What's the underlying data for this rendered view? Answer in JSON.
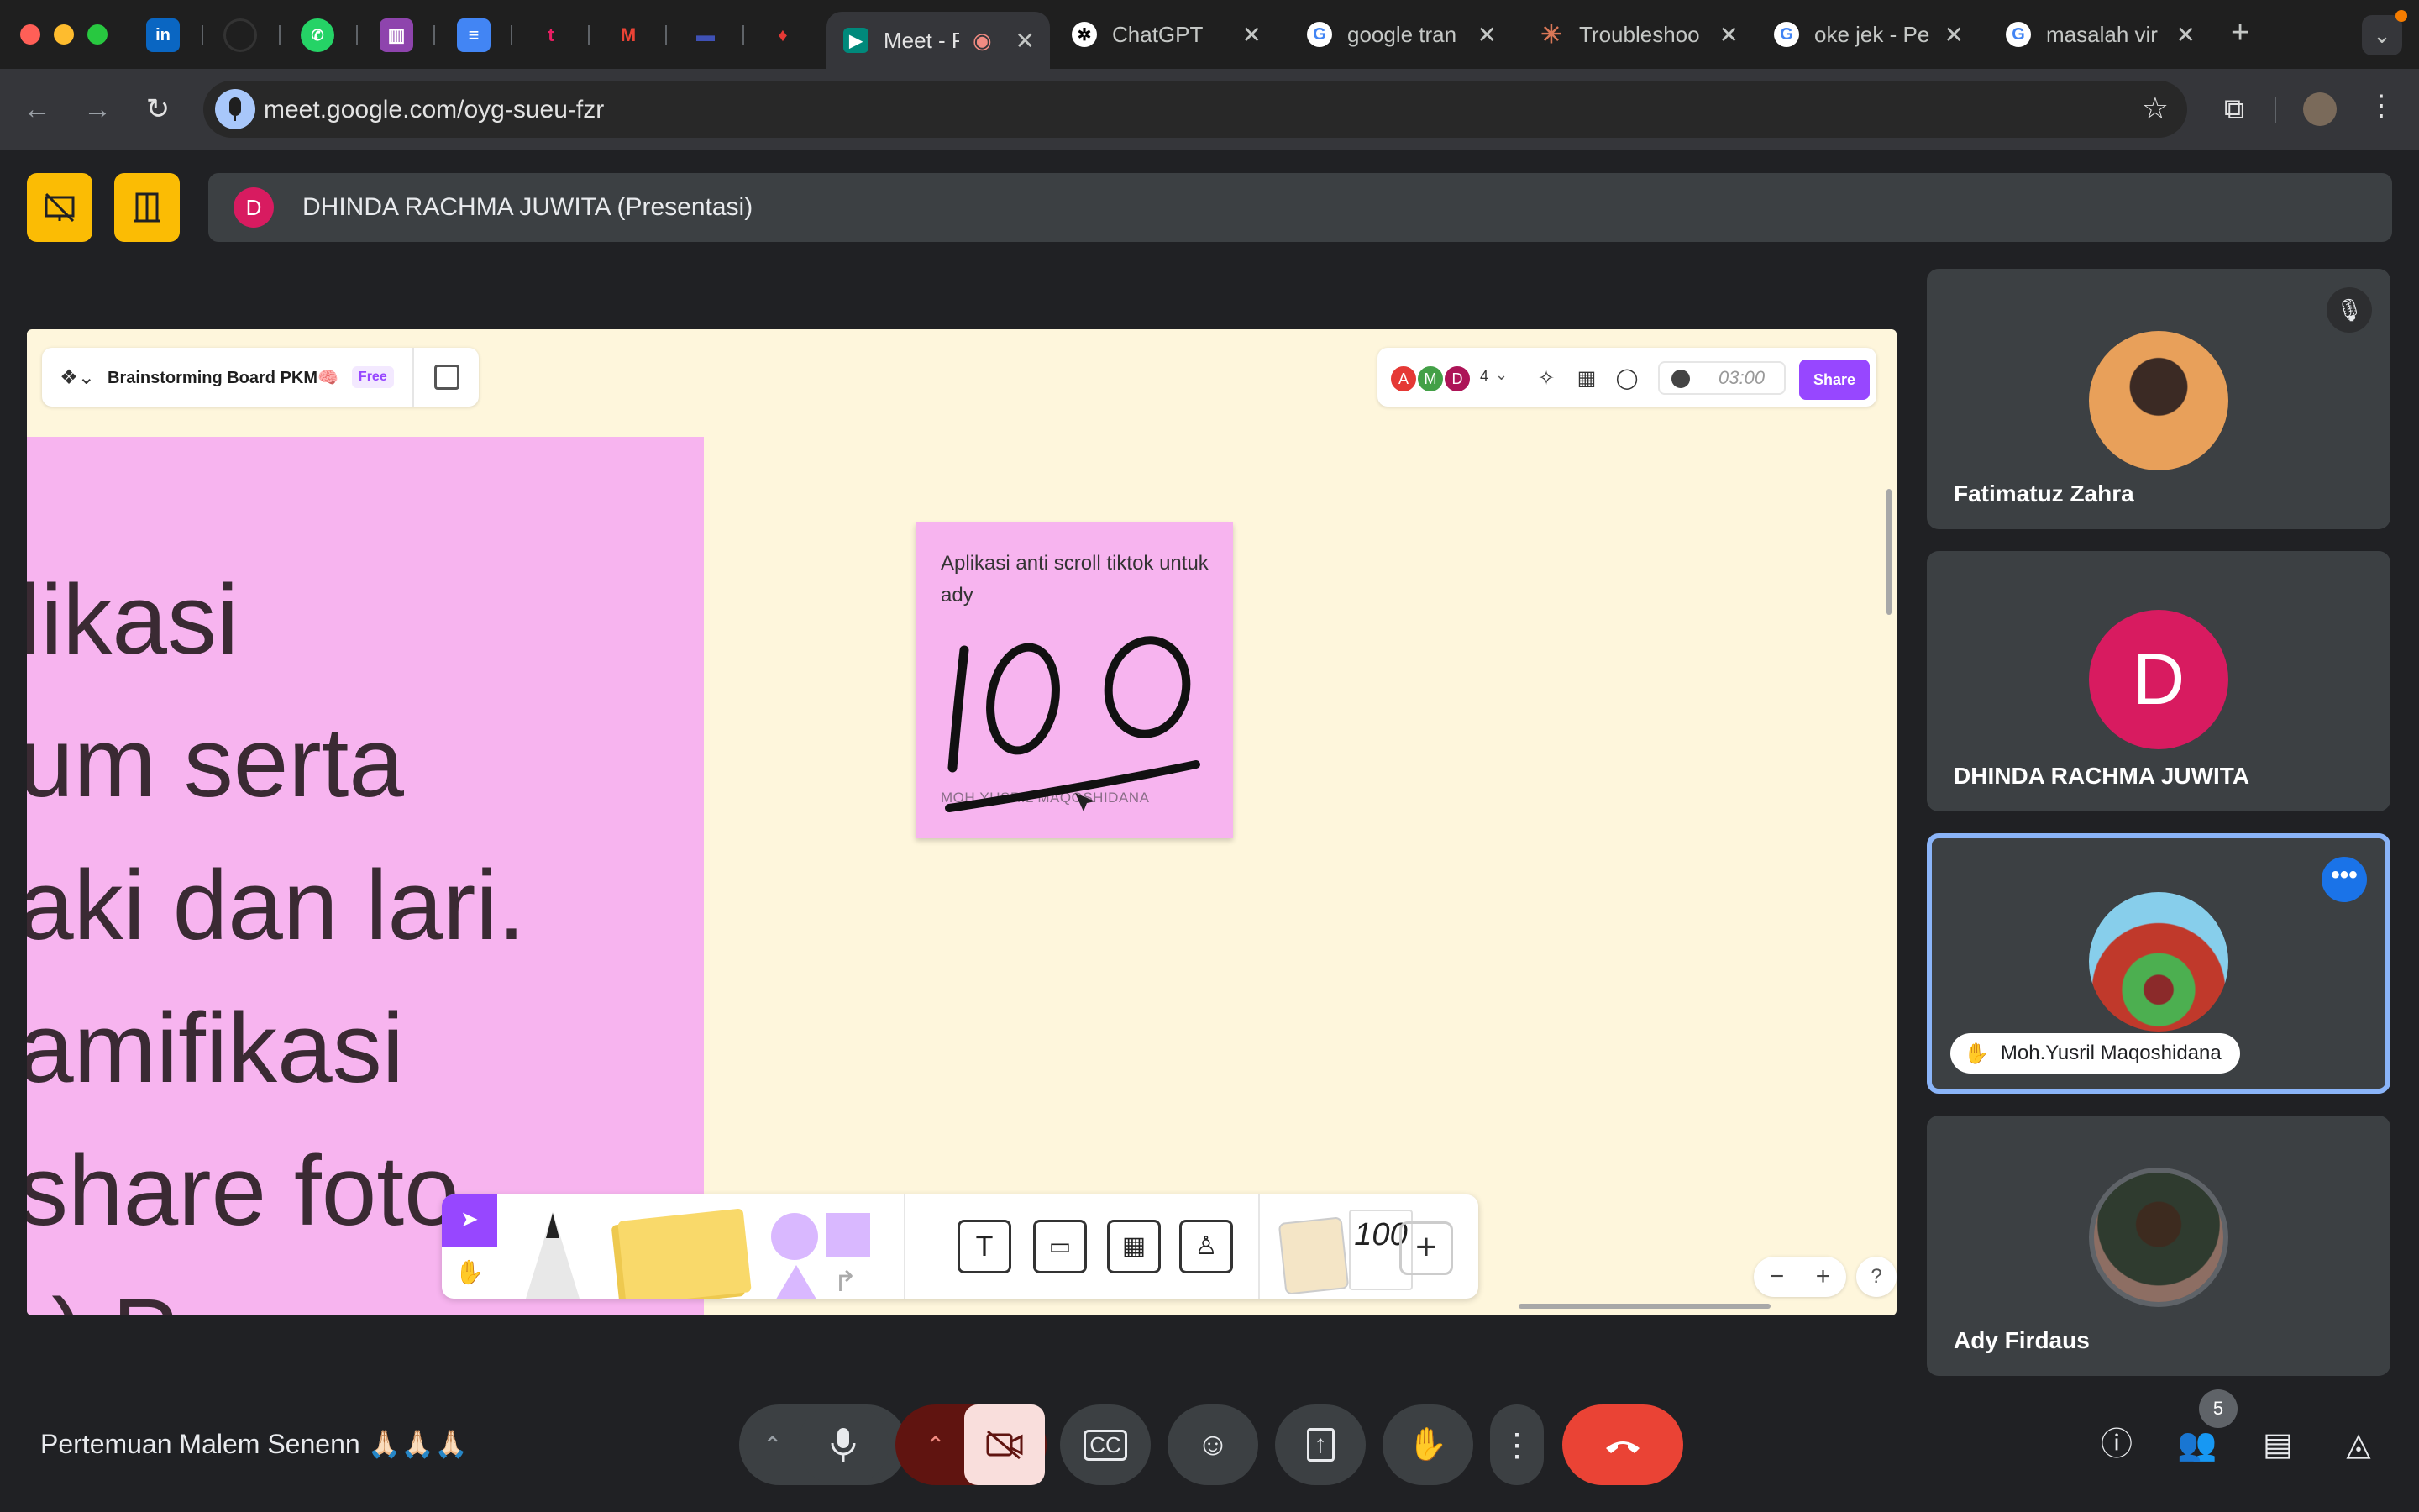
{
  "browser": {
    "tabs": [
      {
        "title": "Meet - P",
        "favicon": "google-meet-icon"
      },
      {
        "title": "ChatGPT",
        "favicon": "chatgpt-icon"
      },
      {
        "title": "google tran",
        "favicon": "google-icon"
      },
      {
        "title": "Troubleshoo",
        "favicon": "claude-icon"
      },
      {
        "title": "oke jek - Pe",
        "favicon": "google-icon"
      },
      {
        "title": "masalah vir",
        "favicon": "google-icon"
      }
    ],
    "pinned_icons": [
      "linkedin-icon",
      "github-icon",
      "whatsapp-icon",
      "trello-icon",
      "docs-icon",
      "tiktok-icon",
      "gmail-icon",
      "bank-icon",
      "app-icon"
    ],
    "url": "meet.google.com/oyg-sueu-fzr"
  },
  "meet": {
    "presenter_initial": "D",
    "presenter_label": "DHINDA RACHMA JUWITA (Presentasi)",
    "meeting_title": "Pertemuan Malem Senenn 🙏🏻🙏🏻🙏🏻",
    "participant_count": "5",
    "participants": [
      {
        "name": "Fatimatuz Zahra",
        "muted": true
      },
      {
        "name": "DHINDA RACHMA JUWITA",
        "initial": "D"
      },
      {
        "name": "Moh.Yusril Maqoshidana",
        "hand_raised": true
      },
      {
        "name": "Ady Firdaus"
      }
    ]
  },
  "figjam": {
    "board_name": "Brainstorming Board PKM🧠",
    "plan_badge": "Free",
    "collaborators": [
      "A",
      "M",
      "D"
    ],
    "collaborator_extra": "4",
    "timer": "03:00",
    "share_label": "Share",
    "pink_lines": [
      "likasi",
      "um serta",
      "aki dan lari.",
      "amifikasi",
      " share foto",
      "·) P  ·  ·  ·"
    ],
    "sticky": {
      "text": "Aplikasi anti scroll tiktok untuk ady",
      "drawing": "100",
      "author": "MOH.YUSRIL MAQOSHIDANA"
    },
    "toolbar_stamp_text": "100",
    "zoom_out": "−",
    "zoom_in": "+",
    "help": "?"
  },
  "colors": {
    "accent_purple": "#9747ff",
    "meet_red": "#ea4335",
    "sticky_pink": "#f7b4ef",
    "canvas": "#fef6dc"
  }
}
